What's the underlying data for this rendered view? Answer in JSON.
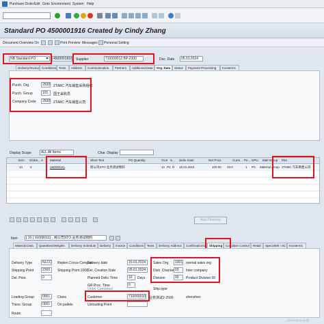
{
  "menu": [
    "Purchase Order",
    "Edit",
    "Goto",
    "Environment",
    "System",
    "Help"
  ],
  "header": {
    "title": "Standard PO 4500001916 Created by Cindy Zhang"
  },
  "app_toolbar": {
    "doc_overview": "Document Overview On",
    "print_preview": "Print Preview",
    "messages": "Messages",
    "personal_setting": "Personal Setting"
  },
  "po_header": {
    "doc_type": "NB Standard PO",
    "po_number": "4500001916",
    "supplier_label": "Supplier",
    "supplier_value": "710000012 BP-2300",
    "doc_date_label": "Doc. Date",
    "doc_date_value": "05.01.2024"
  },
  "header_tabs": [
    {
      "label": "Delivery/Invoice"
    },
    {
      "label": "Conditions"
    },
    {
      "label": "Texts"
    },
    {
      "label": "Address"
    },
    {
      "label": "Communication"
    },
    {
      "label": "Partners"
    },
    {
      "label": "Additional Data"
    },
    {
      "label": "Org. Data"
    },
    {
      "label": "Status"
    },
    {
      "label": "Payment Processing"
    },
    {
      "label": "Incoterms"
    }
  ],
  "org_data": {
    "purch_org_label": "Purch. Org.",
    "purch_org_value": "2500",
    "purch_org_desc": "ZTABC 汽车销售采购组织",
    "purch_group_label": "Purch. Group",
    "purch_group_value": "101",
    "purch_group_desc": "国王采购员",
    "company_code_label": "Company Code",
    "company_code_value": "2500",
    "company_code_desc": "ZTABC 汽车销售公司"
  },
  "items_toolbar": {
    "display_scope_label": "Display Scope",
    "display_scope_value": "ALL All Items",
    "char_display_label": "Char. Display"
  },
  "item_grid": {
    "columns": [
      "Item",
      "Globa...",
      "A",
      "Material",
      "Short Text",
      "PO Quantity",
      "OUn",
      "S...",
      "Deliv. Date",
      "Net Price",
      "Curre...",
      "Pe...",
      "OPU",
      "Matl Group",
      "Plnt"
    ],
    "rows": [
      {
        "item": "10",
        "a": "0",
        "material": "160000111",
        "short_text": "跨公司STO 业务测试物料",
        "qty": "10",
        "oun": "PC",
        "s": "D",
        "deliv_date": "15.01.2024",
        "net_price": "100.00",
        "curr": "CNY",
        "per": "1",
        "opu": "PC",
        "matl_group": "Material group",
        "plnt": "ZTABC 汽车销售公司"
      }
    ],
    "add_planning": "Add Planning"
  },
  "item_detail": {
    "item_label": "Item",
    "item_value": "[ 10 ] 160000111 , 跨公司STO 业务测试物料"
  },
  "item_tabs": [
    {
      "label": "Material Data"
    },
    {
      "label": "Quantities/Weights"
    },
    {
      "label": "Delivery Schedule"
    },
    {
      "label": "Delivery"
    },
    {
      "label": "Invoice"
    },
    {
      "label": "Conditions"
    },
    {
      "label": "Texts"
    },
    {
      "label": "Delivery Address"
    },
    {
      "label": "Confirmations"
    },
    {
      "label": "Shipping"
    },
    {
      "label": "Condition Control"
    },
    {
      "label": "Retail"
    },
    {
      "label": "Spec2000 / SC"
    },
    {
      "label": "Incoterms"
    }
  ],
  "shipping": {
    "delivery_type_label": "Delivery Type",
    "delivery_type_value": "NLCC",
    "shipping_point_label": "Shipping Point",
    "shipping_point_value": "2300",
    "del_prior_label": "Del. Prior.",
    "del_prior_value": "0",
    "route_label": "Route",
    "loading_group_label": "Loading Group",
    "loading_group_value": "0001",
    "trans_group_label": "Trans. Group",
    "trans_group_value": "0001",
    "replen_label": "Replen.Cross-Compan.",
    "shipping_point_desc": "Shipping Point 1000",
    "ctrans_label": "Ctans",
    "on_pallets_label": "On pallets",
    "delivery_date_label": "Delivery date",
    "delivery_date_value": "15.01.2024",
    "deliv_creation_label": "Del. Creation Date",
    "deliv_creation_value": "05.01.2024",
    "planned_deliv_label": "Planned Deliv. Time",
    "planned_deliv_value": "10",
    "planned_deliv_unit": "Days",
    "gr_proc_label": "GR Proc. Time",
    "gr_proc_value": "0",
    "order_combined_label": "Order Combined",
    "customer_label": "Customer",
    "customer_value": "710000010",
    "customer_desc": "业务测试2-2500",
    "unloading_point_label": "Unloading Point",
    "sales_org_label": "Sales Org.",
    "sales_org_value": "1001",
    "sales_org_desc": "normal sales org",
    "distr_channel_label": "Distr. Channel",
    "distr_channel_value": "03",
    "distr_channel_desc": "Inter company",
    "division_label": "Division",
    "division_value": "00",
    "division_desc": "Product Division 00",
    "ship_type_label": "Ship.type",
    "city_value": "shenzhen"
  },
  "watermark": "CSDN @Cindy 张"
}
